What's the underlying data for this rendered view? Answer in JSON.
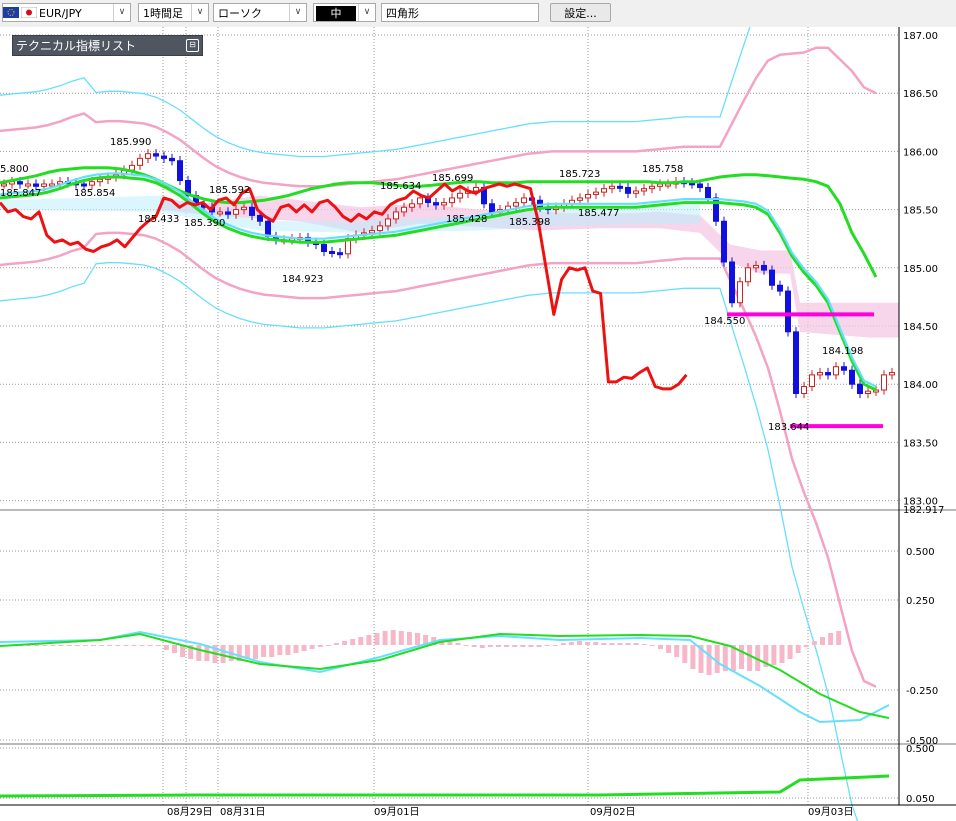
{
  "toolbar": {
    "pair": "EUR/JPY",
    "timeframe": "1時間足",
    "chart_style": "ローソク",
    "line_width": "中",
    "shape": "四角形",
    "settings_label": "設定..."
  },
  "indicator_panel": {
    "title": "テクニカル指標リスト",
    "minimize_glyph": "⊟"
  },
  "colors": {
    "bull_candle": "#d02020",
    "bear_candle": "#1010e0",
    "red_line": "#ee1111",
    "green_line": "#22dd22",
    "cyan": "#66dfff",
    "pink": "#f3a3c3",
    "cloud": "#f4c8e4",
    "magenta": "#ff00dd",
    "histogram": "#f6b8c8"
  },
  "chart_data": [
    {
      "type": "line",
      "subtype": "candlestick",
      "y_ticks": [
        "187.00",
        "186.50",
        "186.00",
        "185.50",
        "185.00",
        "184.50",
        "184.00",
        "183.50",
        "183.00"
      ],
      "ylim": [
        182.917,
        187.05
      ],
      "current_value_label": "182.917",
      "x_ticks": [
        "08月29日",
        "08月31日",
        "09月01日",
        "09月02日",
        "09月03日"
      ],
      "price_labels": [
        "185.990",
        "185.847",
        "185.854",
        "185.433",
        "185.592",
        "185.390",
        "184.923",
        "185.634",
        "185.699",
        "185.428",
        "185.398",
        "185.723",
        "185.477",
        "185.758",
        "184.550",
        "183.644",
        "184.198"
      ],
      "partial_label": "5.800",
      "series": [
        {
          "name": "",
          "role": "candle_close",
          "values": [
            185.72,
            185.74,
            185.72,
            185.72,
            185.7,
            185.72,
            185.72,
            185.74,
            185.73,
            185.72,
            185.71,
            185.74,
            185.76,
            185.78,
            185.8,
            185.84,
            185.88,
            185.94,
            185.98,
            185.96,
            185.94,
            185.92,
            185.75,
            185.62,
            185.54,
            185.52,
            185.48,
            185.48,
            185.46,
            185.5,
            185.52,
            185.45,
            185.4,
            185.27,
            185.24,
            185.24,
            185.25,
            185.26,
            185.22,
            185.2,
            185.14,
            185.13,
            185.12,
            185.25,
            185.28,
            185.3,
            185.32,
            185.36,
            185.42,
            185.48,
            185.52,
            185.55,
            185.6,
            185.56,
            185.54,
            185.56,
            185.6,
            185.64,
            185.66,
            185.69,
            185.55,
            185.48,
            185.5,
            185.53,
            185.56,
            185.6,
            185.58,
            185.52,
            185.5,
            185.52,
            185.55,
            185.58,
            185.6,
            185.63,
            185.65,
            185.68,
            185.7,
            185.69,
            185.64,
            185.66,
            185.68,
            185.7,
            185.72,
            185.72,
            185.74,
            185.73,
            185.72,
            185.69,
            185.6,
            185.4,
            185.05,
            184.7,
            184.88,
            185.0,
            185.02,
            184.98,
            184.85,
            184.8,
            184.45,
            183.92,
            183.98,
            184.08,
            184.1,
            184.08,
            184.15,
            184.12,
            184.0,
            183.92,
            183.94,
            183.95,
            184.08,
            184.1
          ]
        },
        {
          "name": "",
          "role": "red_line",
          "values": [
            185.56,
            185.48,
            185.5,
            185.44,
            185.42,
            185.48,
            185.28,
            185.22,
            185.24,
            185.2,
            185.22,
            185.16,
            185.14,
            185.18,
            185.2,
            185.24,
            185.18,
            185.26,
            185.34,
            185.4,
            185.44,
            185.6,
            185.58,
            185.52,
            185.56,
            185.54,
            185.56,
            185.5,
            185.58,
            185.6,
            185.54,
            185.64,
            185.68,
            185.5,
            185.44,
            185.4,
            185.52,
            185.54,
            185.48,
            185.54,
            185.48,
            185.56,
            185.58,
            185.52,
            185.44,
            185.4,
            185.46,
            185.42,
            185.48,
            185.46,
            185.54,
            185.58,
            185.6,
            185.66,
            185.62,
            185.6,
            185.66,
            185.72,
            185.66,
            185.7,
            185.66,
            185.64,
            185.68,
            185.7,
            185.72,
            185.7,
            185.72,
            185.7,
            185.68,
            185.4,
            185.0,
            184.6,
            184.9,
            185.0,
            184.98,
            185.0,
            184.8,
            184.78,
            184.02,
            184.02,
            184.06,
            184.05,
            184.1,
            184.14,
            183.98,
            183.96,
            183.96,
            184.0,
            184.08
          ]
        },
        {
          "name": "",
          "role": "green_mid",
          "values": [
            185.6,
            185.61,
            185.62,
            185.63,
            185.65,
            185.68,
            185.72,
            185.75,
            185.77,
            185.78,
            185.78,
            185.77,
            185.76,
            185.73,
            185.68,
            185.62,
            185.54,
            185.46,
            185.39,
            185.34,
            185.3,
            185.27,
            185.25,
            185.24,
            185.23,
            185.22,
            185.22,
            185.22,
            185.23,
            185.24,
            185.25,
            185.26,
            185.27,
            185.28,
            185.3,
            185.32,
            185.34,
            185.36,
            185.38,
            185.4,
            185.42,
            185.44,
            185.46,
            185.48,
            185.5,
            185.51,
            185.52,
            185.52,
            185.52,
            185.52,
            185.52,
            185.52,
            185.52,
            185.52,
            185.53,
            185.54,
            185.55,
            185.56,
            185.56,
            185.56,
            185.56,
            185.55,
            185.54,
            185.52,
            185.46,
            185.3,
            185.1,
            184.96,
            184.85,
            184.7,
            184.45,
            184.2,
            184.0,
            183.95
          ]
        },
        {
          "name": "",
          "role": "green_upper",
          "values": [
            185.73,
            185.75,
            185.77,
            185.79,
            185.82,
            185.84,
            185.85,
            185.86,
            185.86,
            185.86,
            185.85,
            185.83,
            185.8,
            185.76,
            185.71,
            185.66,
            185.62,
            185.59,
            185.57,
            185.56,
            185.56,
            185.57,
            185.58,
            185.6,
            185.62,
            185.65,
            185.68,
            185.7,
            185.72,
            185.73,
            185.73,
            185.73,
            185.72,
            185.71,
            185.7,
            185.7,
            185.71,
            185.72,
            185.73,
            185.74,
            185.74,
            185.73,
            185.73,
            185.73,
            185.74,
            185.74,
            185.74,
            185.74,
            185.74,
            185.74,
            185.74,
            185.74,
            185.74,
            185.74,
            185.74,
            185.73,
            185.73,
            185.74,
            185.74,
            185.76,
            185.78,
            185.79,
            185.8,
            185.8,
            185.79,
            185.78,
            185.77,
            185.76,
            185.74,
            185.7,
            185.55,
            185.3,
            185.12,
            184.92
          ]
        }
      ]
    },
    {
      "type": "line",
      "subtype": "oscillator",
      "y_ticks": [
        "0.500",
        "0.250",
        "-0.250",
        "-0.500"
      ],
      "ylim": [
        -0.5,
        0.5
      ]
    },
    {
      "type": "line",
      "subtype": "oscillator",
      "y_ticks": [
        "0.500",
        "0.050"
      ],
      "ylim": [
        0.05,
        0.5
      ]
    }
  ]
}
